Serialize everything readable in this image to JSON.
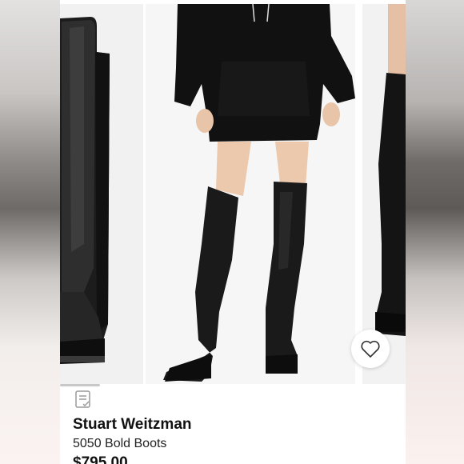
{
  "listing": {
    "brand": "Stuart Weitzman",
    "title": "5050 Bold Boots",
    "price": "$795.00"
  },
  "images": [
    {
      "icon": "boot-side-photo"
    },
    {
      "icon": "model-wearing-boots-photo"
    },
    {
      "icon": "boot-partial-photo"
    }
  ],
  "icons": {
    "like": "heart-icon",
    "details": "document-check-icon"
  },
  "colors": {
    "card_bg": "#ffffff",
    "photo_bg": "#f3f3f3",
    "boot": "#1a1a1a",
    "text": "#111111"
  }
}
